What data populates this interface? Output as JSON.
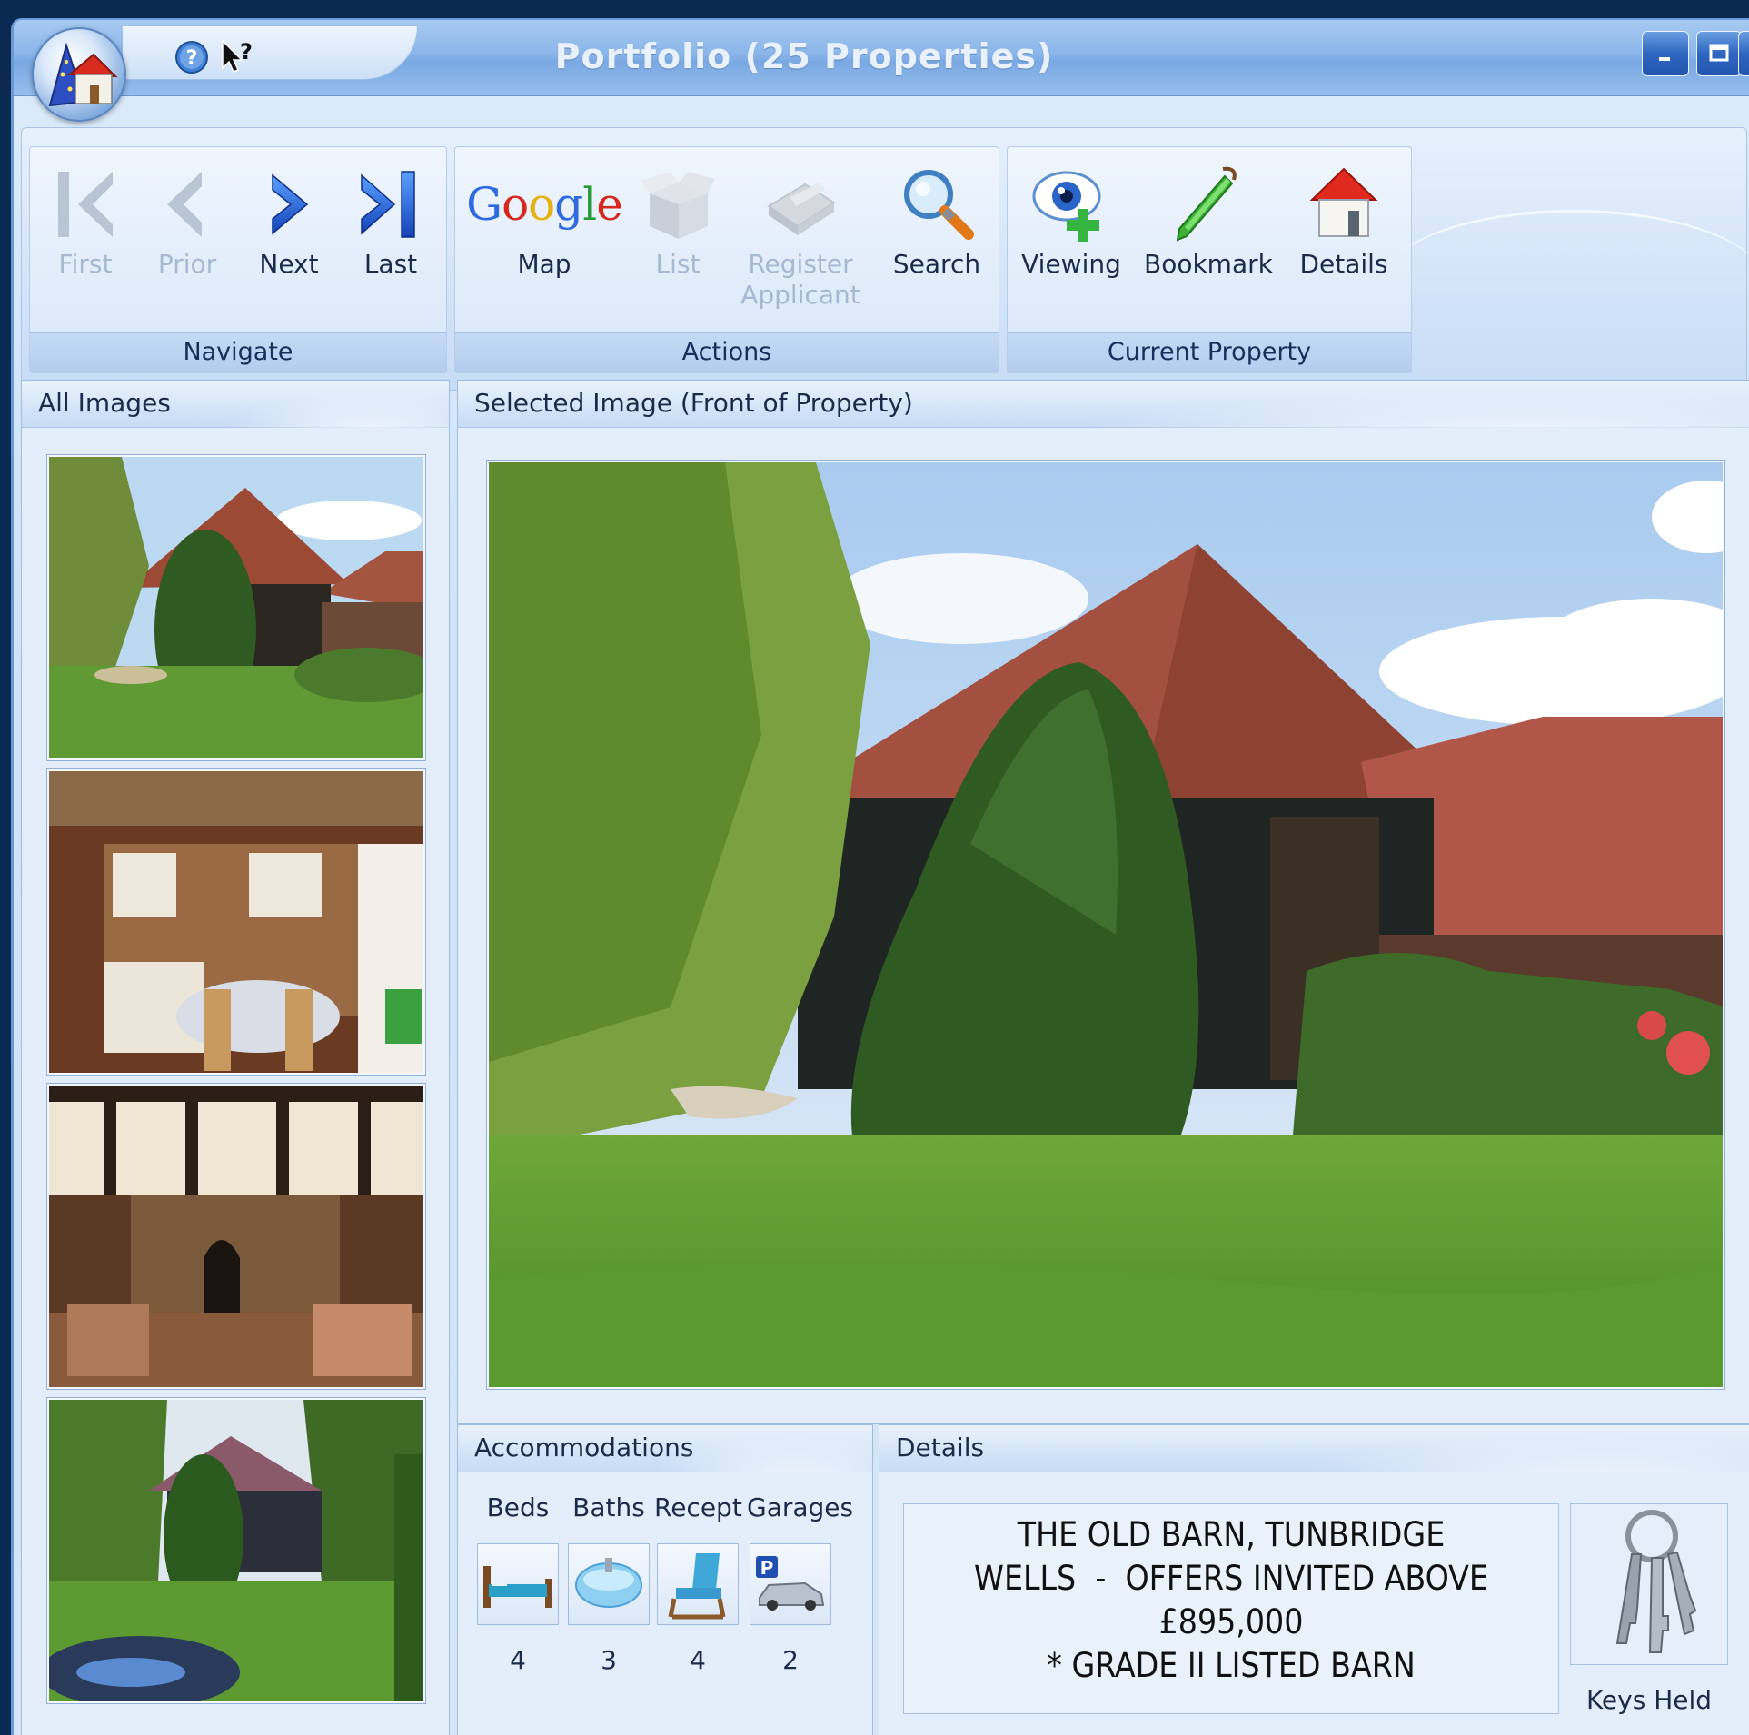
{
  "window": {
    "title": "Portfolio (25 Properties)"
  },
  "ribbon": {
    "groups": [
      {
        "label": "Navigate",
        "buttons": [
          {
            "label": "First",
            "icon": "first-arrow-icon",
            "enabled": false
          },
          {
            "label": "Prior",
            "icon": "prior-arrow-icon",
            "enabled": false
          },
          {
            "label": "Next",
            "icon": "next-arrow-icon",
            "enabled": true
          },
          {
            "label": "Last",
            "icon": "last-arrow-icon",
            "enabled": true
          }
        ]
      },
      {
        "label": "Actions",
        "buttons": [
          {
            "label": "Map",
            "icon": "google-logo-icon",
            "enabled": true
          },
          {
            "label": "List",
            "icon": "box-icon",
            "enabled": false
          },
          {
            "label": "Register Applicant",
            "icon": "register-icon",
            "enabled": false
          },
          {
            "label": "Search",
            "icon": "magnifier-icon",
            "enabled": true
          }
        ]
      },
      {
        "label": "Current Property",
        "buttons": [
          {
            "label": "Viewing",
            "icon": "eye-plus-icon",
            "enabled": true
          },
          {
            "label": "Bookmark",
            "icon": "bookmark-icon",
            "enabled": true
          },
          {
            "label": "Details",
            "icon": "house-icon",
            "enabled": true
          }
        ]
      }
    ],
    "google_logo_text": "Google"
  },
  "all_images": {
    "title": "All Images",
    "thumbnails": [
      "barn-exterior",
      "kitchen",
      "living-room",
      "garden-pond"
    ]
  },
  "selected_image": {
    "title": "Selected Image (Front of Property)"
  },
  "accommodations": {
    "title": "Accommodations",
    "items": [
      {
        "label": "Beds",
        "value": "4",
        "icon": "bed-icon"
      },
      {
        "label": "Baths",
        "value": "3",
        "icon": "bath-icon"
      },
      {
        "label": "Recept",
        "value": "4",
        "icon": "chair-icon"
      },
      {
        "label": "Garages",
        "value": "2",
        "icon": "car-parking-icon"
      }
    ]
  },
  "details": {
    "title": "Details",
    "lines": [
      "THE OLD BARN, TUNBRIDGE",
      "WELLS  -  OFFERS INVITED ABOVE",
      "£895,000",
      "* GRADE II LISTED BARN"
    ],
    "keys_label": "Keys Held"
  },
  "colors": {
    "titlebar": "#8bb6ea",
    "panel": "#e4eefa",
    "accent_blue": "#2a64c8"
  }
}
